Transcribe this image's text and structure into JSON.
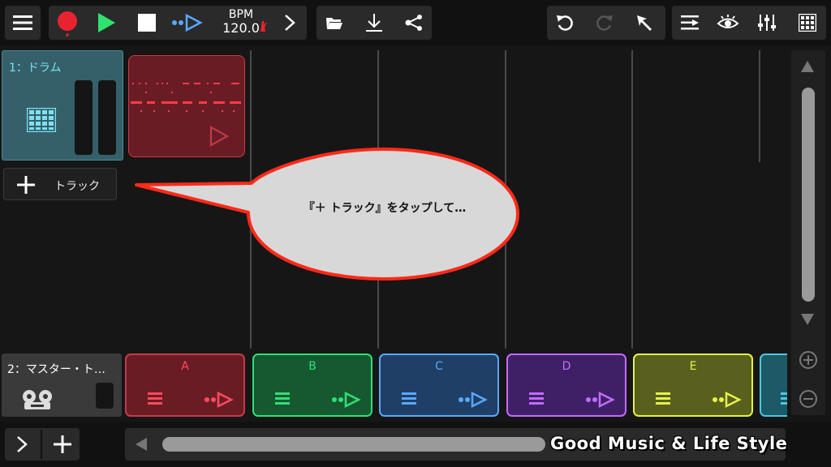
{
  "toolbar": {
    "bpm_label": "BPM",
    "bpm_value": "120.0"
  },
  "track1": {
    "name": "1：ドラム"
  },
  "add_track": {
    "label": "トラック"
  },
  "bubble": {
    "text": "『＋ トラック』をタップして…"
  },
  "track2": {
    "name": "2：マスター・ト…"
  },
  "clips": [
    {
      "label": "A",
      "color": "#ff4b5c"
    },
    {
      "label": "B",
      "color": "#2fe07a"
    },
    {
      "label": "C",
      "color": "#5aa8ff"
    },
    {
      "label": "D",
      "color": "#c36bff"
    },
    {
      "label": "E",
      "color": "#e5f34a"
    }
  ],
  "watermark": {
    "text": "Good Music & Life Style"
  },
  "colors": {
    "accent_cyan": "#7ee1f2",
    "record_red": "#e8232f",
    "play_green": "#2ee36f"
  }
}
